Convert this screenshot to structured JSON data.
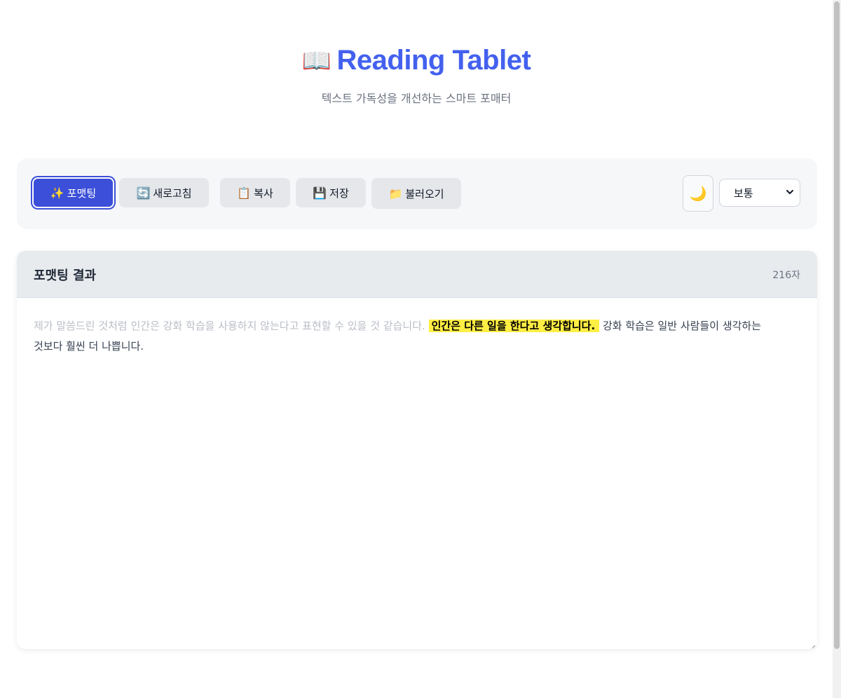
{
  "header": {
    "title_icon": "📖",
    "title": "Reading Tablet",
    "subtitle": "텍스트 가독성을 개선하는 스마트 포매터"
  },
  "toolbar": {
    "format": {
      "icon": "✨",
      "label": "포맷팅"
    },
    "refresh": {
      "icon": "🔄",
      "label": "새로고침"
    },
    "copy": {
      "icon": "📋",
      "label": "복사"
    },
    "save": {
      "icon": "💾",
      "label": "저장"
    },
    "load": {
      "icon": "📁",
      "label": "불러오기"
    },
    "theme_icon": "🌙",
    "speed_select": {
      "selected": "보통"
    }
  },
  "result": {
    "title": "포맷팅 결과",
    "char_count": "216자",
    "text_faded": "제가 말씀드린 것처럼 인간은 강화 학습을 사용하지 않는다고 표현할 수 있을 것 같습니다.",
    "text_highlight": "인간은 다른 일을 한다고 생각합니다.",
    "text_normal": "강화 학습은 일반 사람들이 생각하는 것보다 훨씬 더 나쁩니다."
  },
  "colors": {
    "accent": "#4361ee",
    "primary_button": "#3b4fd8",
    "highlight": "#ffee44"
  }
}
